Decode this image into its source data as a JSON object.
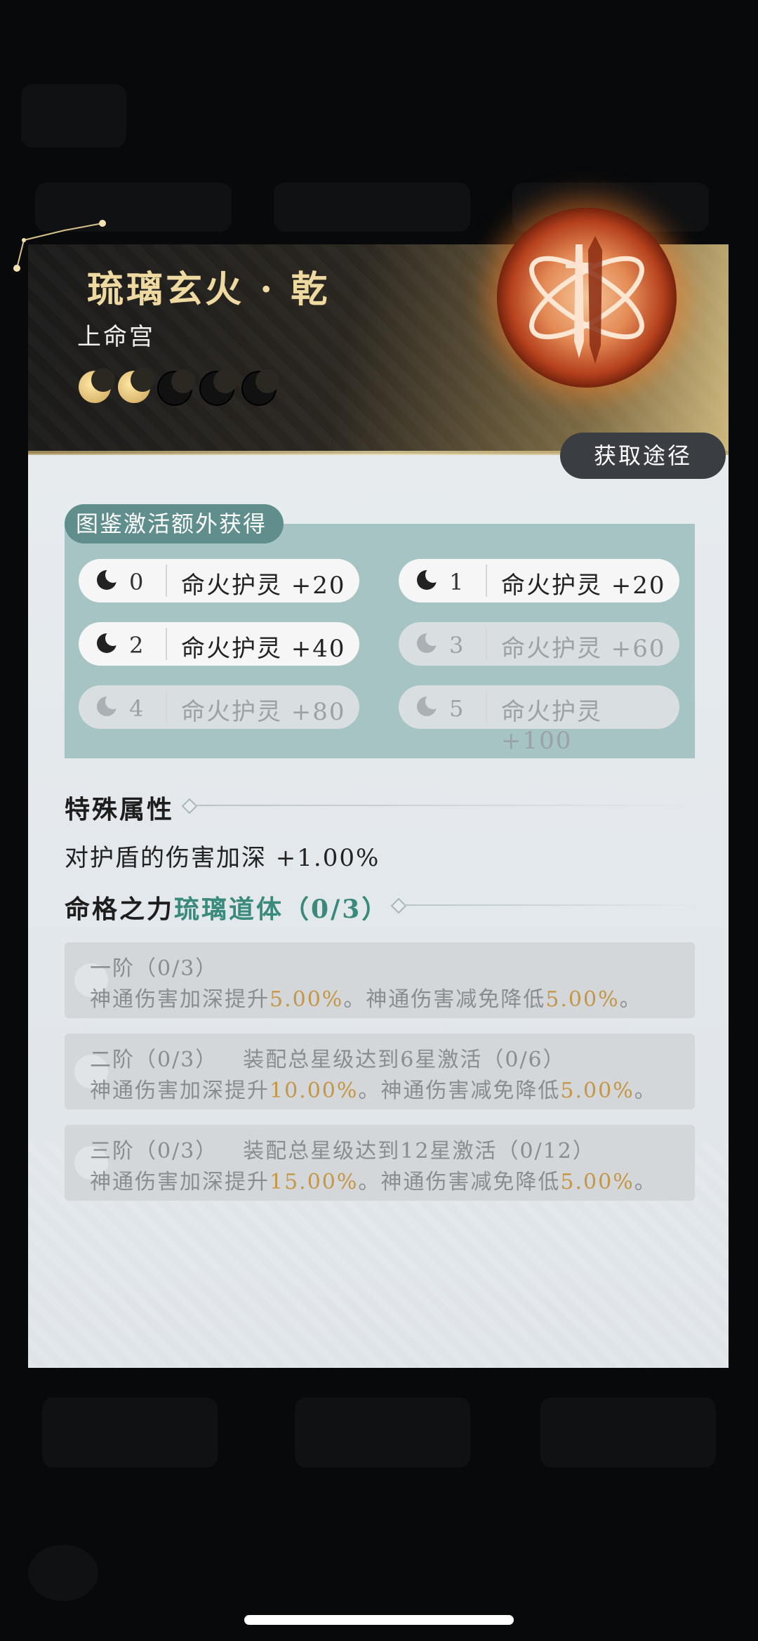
{
  "card": {
    "title": "琉璃玄火 · 乾",
    "subtitle": "上命宫",
    "stars": {
      "filled": 2,
      "total": 5
    },
    "acquire_label": "获取途径",
    "emblem_icon": "crossed-swords-fire-emblem"
  },
  "gallery": {
    "tag": "图鉴激活额外获得",
    "items": [
      {
        "level": "0",
        "text": "命火护灵 +20",
        "active": true
      },
      {
        "level": "1",
        "text": "命火护灵 +20",
        "active": true
      },
      {
        "level": "2",
        "text": "命火护灵 +40",
        "active": true
      },
      {
        "level": "3",
        "text": "命火护灵 +60",
        "active": false
      },
      {
        "level": "4",
        "text": "命火护灵 +80",
        "active": false
      },
      {
        "level": "5",
        "text": "命火护灵 +100",
        "active": false
      }
    ]
  },
  "special": {
    "heading": "特殊属性",
    "desc": "对护盾的伤害加深 +1.00%"
  },
  "fate": {
    "heading": "命格之力",
    "name": "琉璃道体（0/3）",
    "tiers": [
      {
        "title": "一阶（0/3）",
        "requirement": "",
        "line_a": "神通伤害加深提升",
        "val_a": "5.00%",
        "line_b": "。神通伤害减免降低",
        "val_b": "5.00%",
        "end": "。"
      },
      {
        "title": "二阶（0/3）",
        "requirement": "装配总星级达到6星激活（0/6）",
        "line_a": "神通伤害加深提升",
        "val_a": "10.00%",
        "line_b": "。神通伤害减免降低",
        "val_b": "5.00%",
        "end": "。"
      },
      {
        "title": "三阶（0/3）",
        "requirement": "装配总星级达到12星激活（0/12）",
        "line_a": "神通伤害加深提升",
        "val_a": "15.00%",
        "line_b": "。神通伤害减免降低",
        "val_b": "5.00%",
        "end": "。"
      }
    ]
  },
  "colors": {
    "accent_teal": "#5f8e8c",
    "highlight_gold": "#c49645",
    "title_gold": "#eed9a1"
  }
}
